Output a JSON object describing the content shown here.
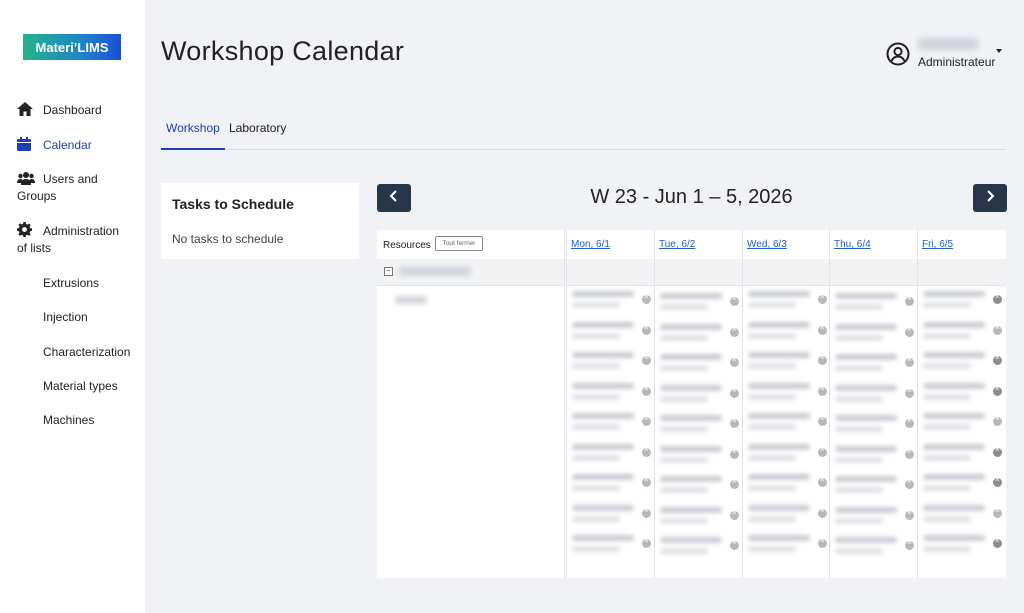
{
  "app": {
    "logo_text": "Materi’LIMS"
  },
  "sidebar": {
    "items": [
      {
        "label": "Dashboard",
        "icon": "home-icon",
        "active": false
      },
      {
        "label": "Calendar",
        "icon": "calendar-icon",
        "active": true
      },
      {
        "label_line1": "Users and",
        "label_line2": "Groups",
        "icon": "users-icon",
        "active": false
      },
      {
        "label_line1": "Administration",
        "label_line2": "of lists",
        "icon": "gear-icon",
        "active": false
      }
    ],
    "sub_items": [
      "Extrusions",
      "Injection",
      "Characterization",
      "Material types",
      "Machines"
    ]
  },
  "header": {
    "title": "Workshop Calendar",
    "user": {
      "role": "Administrateur",
      "icon": "user-circle-icon"
    }
  },
  "tabs": [
    {
      "label": "Workshop",
      "active": true
    },
    {
      "label": "Laboratory",
      "active": false
    }
  ],
  "tasks": {
    "title": "Tasks to Schedule",
    "empty_text": "No tasks to schedule"
  },
  "calendar": {
    "week_title": "W 23 - Jun 1 – 5, 2026",
    "prev_icon": "chevron-left-icon",
    "next_icon": "chevron-right-icon",
    "resources_label": "Resources",
    "collapse_label": "Tout fermer",
    "days": [
      "Mon, 6/1",
      "Tue, 6/2",
      "Wed, 6/3",
      "Thu, 6/4",
      "Fri, 6/5"
    ]
  },
  "colors": {
    "accent": "#1d3fb3",
    "nav_button": "#283649",
    "link": "#1f5fc8"
  }
}
